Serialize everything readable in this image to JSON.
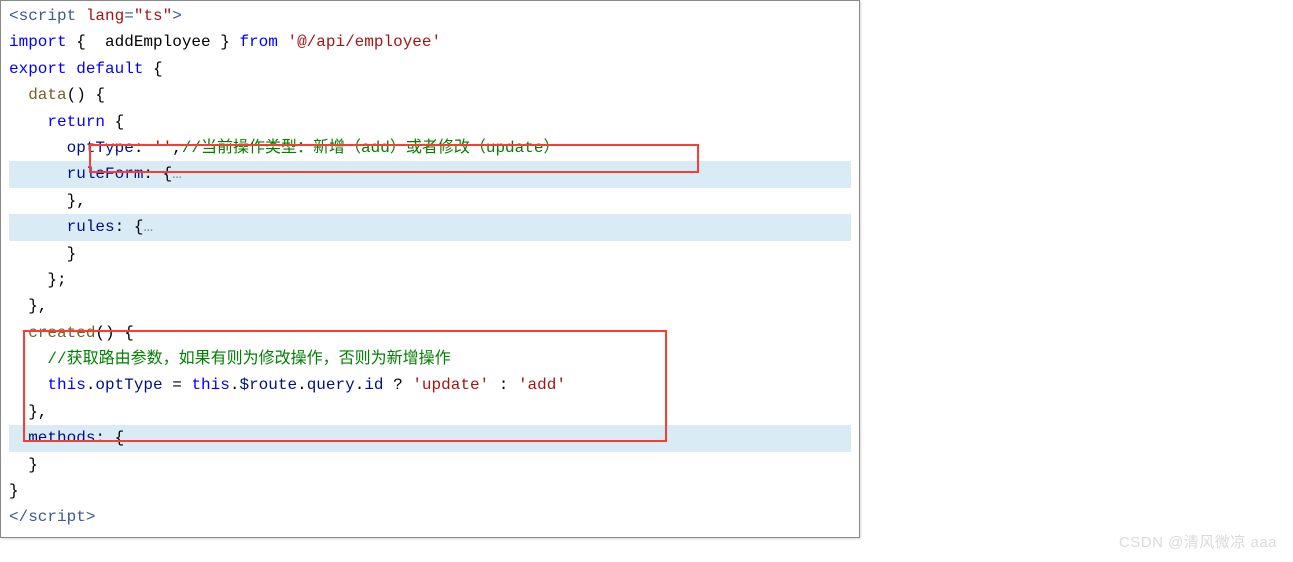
{
  "code": {
    "line1_open": "<script",
    "line1_attr": " lang",
    "line1_eq": "=",
    "line1_val": "\"ts\"",
    "line1_close": ">",
    "line2_kw1": "import",
    "line2_brace": " {  ",
    "line2_name": "addEmployee",
    "line2_brace2": " } ",
    "line2_from": "from",
    "line2_sp": " ",
    "line2_str": "'@/api/employee'",
    "line3_a": "export",
    "line3_b": " default",
    "line3_c": " {",
    "line4": "  data() {",
    "line4_fn": "data",
    "line4_paren": "() {",
    "line5_kw": "return",
    "line5_brace": " {",
    "line6_prop": "optType",
    "line6_colon": ": ",
    "line6_val": "''",
    "line6_comma": ",",
    "line6_comment": "//当前操作类型：新增（add）或者修改（update）",
    "line7_prop": "ruleForm",
    "line7_rest": ": {",
    "line7_ell": "…",
    "line8": "},",
    "line9_prop": "rules",
    "line9_rest": ": {",
    "line9_ell": "…",
    "line10": "}",
    "line11": "};",
    "line12": "},",
    "line13_fn": "created",
    "line13_rest": "() {",
    "line14_comment": "//获取路由参数，如果有则为修改操作，否则为新增操作",
    "line15_this1": "this",
    "line15_a": ".",
    "line15_opt": "optType",
    "line15_b": " = ",
    "line15_this2": "this",
    "line15_c": ".",
    "line15_route": "$route",
    "line15_d": ".",
    "line15_query": "query",
    "line15_e": ".",
    "line15_id": "id",
    "line15_f": " ? ",
    "line15_s1": "'update'",
    "line15_g": " : ",
    "line15_s2": "'add'",
    "line16": "},",
    "line17_prop": "methods",
    "line17_rest": ": {",
    "line17_ell": "…",
    "line18": "}",
    "line19": "}",
    "line20_open": "</",
    "line20_tag": "script",
    "line20_close": ">"
  },
  "watermark": "CSDN @清风微凉 aaa"
}
